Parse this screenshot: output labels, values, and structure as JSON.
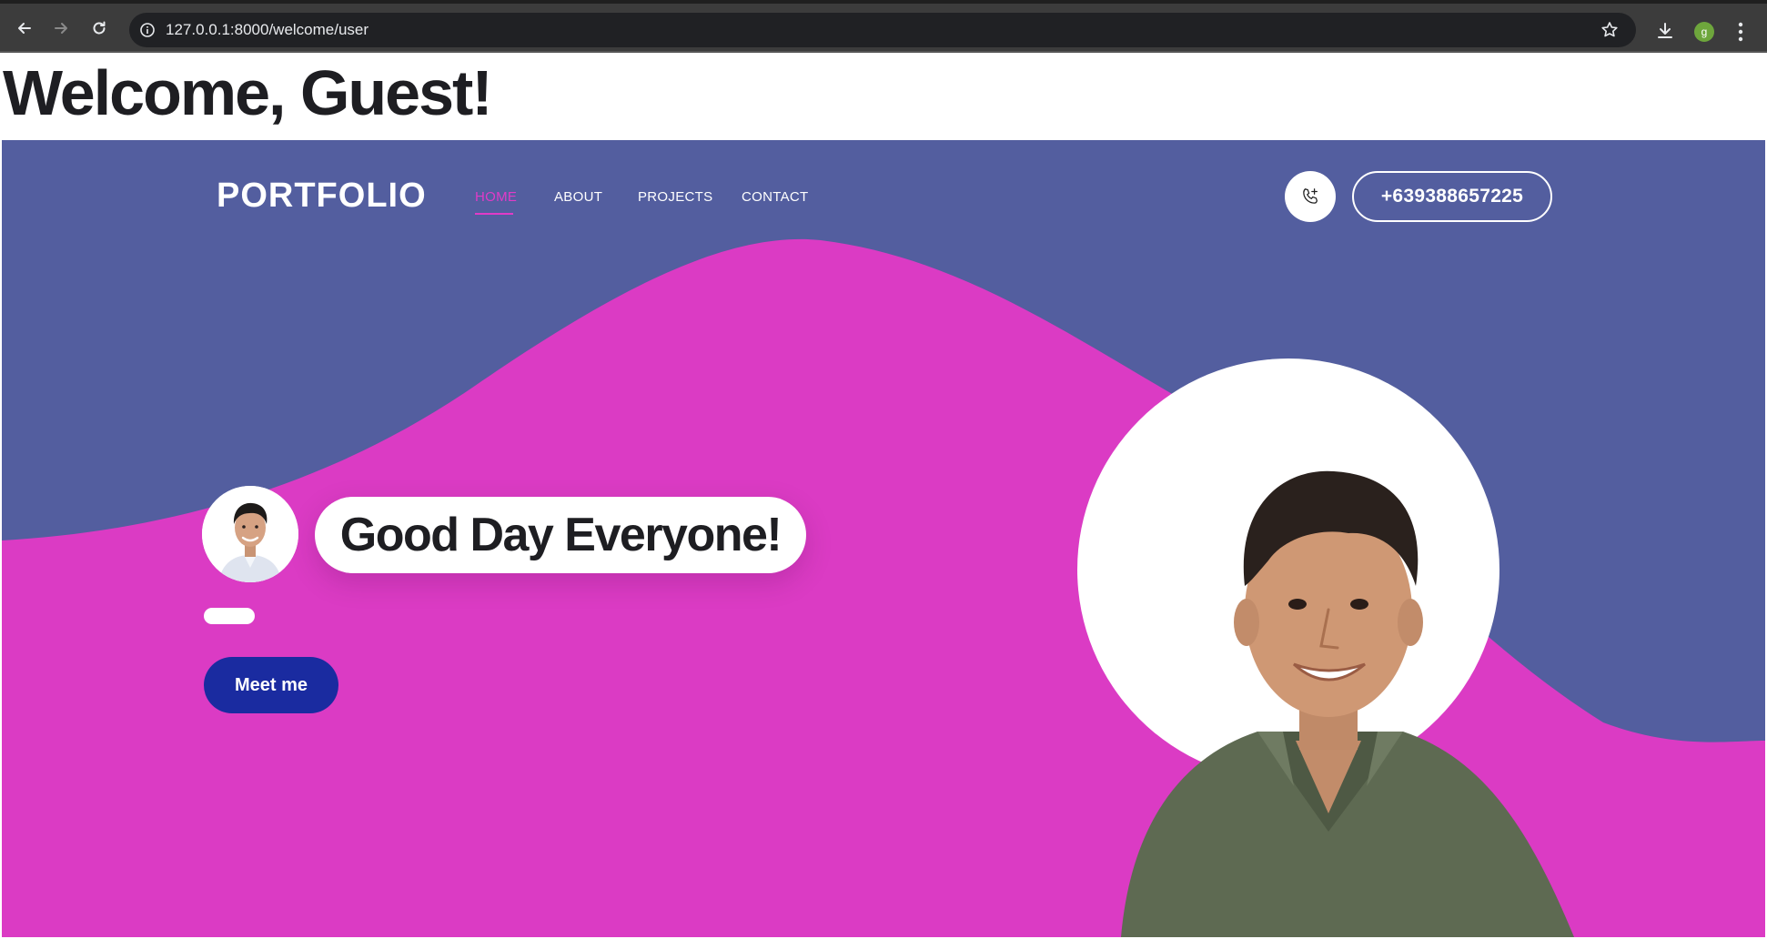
{
  "browser": {
    "url": "127.0.0.1:8000/welcome/user",
    "profile_initial": "g"
  },
  "page": {
    "heading": "Welcome, Guest!"
  },
  "navbar": {
    "logo": "PORTFOLIO",
    "links": [
      {
        "label": "HOME",
        "active": true
      },
      {
        "label": "ABOUT",
        "active": false
      },
      {
        "label": "PROJECTS",
        "active": false
      },
      {
        "label": "CONTACT",
        "active": false
      }
    ],
    "phone": "+639388657225"
  },
  "hero": {
    "greeting": "Good Day Everyone!",
    "cta_label": "Meet me"
  },
  "colors": {
    "hero_background": "#535e9f",
    "wave": "#db3bc4",
    "accent": "#e03bc8",
    "cta": "#1a2ba0"
  }
}
